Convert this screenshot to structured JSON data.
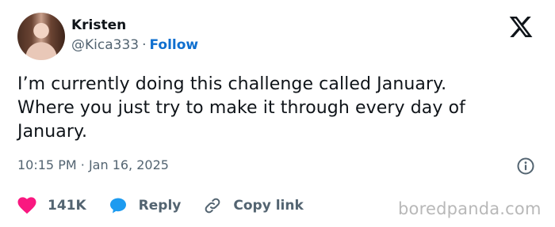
{
  "tweet": {
    "author": {
      "name": "Kristen",
      "handle": "@Kica333",
      "separator": "·",
      "follow_label": "Follow"
    },
    "text_lines": [
      "I’m currently doing this challenge called January.",
      "Where you just try to make it through every day of",
      "January."
    ],
    "meta": {
      "time": "10:15 PM",
      "separator": "·",
      "date": "Jan 16, 2025"
    },
    "actions": {
      "likes": "141K",
      "reply_label": "Reply",
      "copy_link_label": "Copy link"
    }
  },
  "icons": {
    "brand": "x-logo-icon",
    "info": "info-icon",
    "like": "heart-icon",
    "reply": "speech-bubble-icon",
    "copy_link": "link-icon"
  },
  "colors": {
    "heart": "#f91880",
    "reply": "#1d9bf0",
    "follow": "#0f6fcf",
    "muted": "#536471"
  },
  "watermark": "boredpanda.com"
}
